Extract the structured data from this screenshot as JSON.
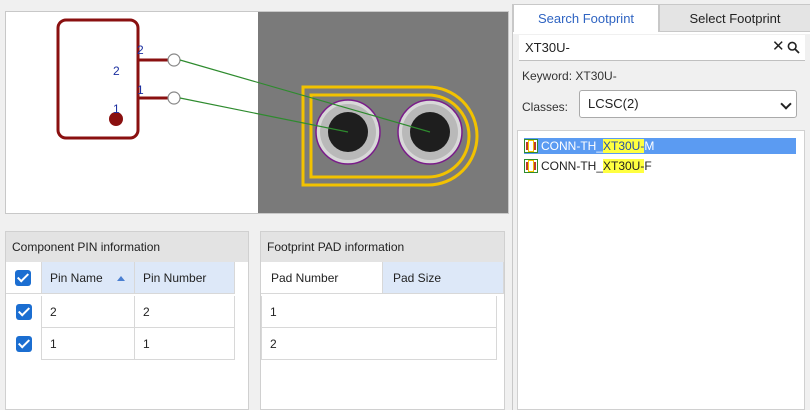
{
  "preview": {
    "symbol_pins": [
      {
        "label": "2",
        "number": "2"
      },
      {
        "label": "1",
        "number": "1"
      }
    ]
  },
  "pin_table": {
    "title": "Component PIN information",
    "columns": [
      "Pin Name",
      "Pin Number"
    ],
    "rows": [
      {
        "pin_name": "2",
        "pin_number": "2"
      },
      {
        "pin_name": "1",
        "pin_number": "1"
      }
    ]
  },
  "pad_table": {
    "title": "Footprint PAD information",
    "columns": [
      "Pad Number",
      "Pad Size"
    ],
    "rows": [
      {
        "pad_number": "1",
        "pad_size": ""
      },
      {
        "pad_number": "2",
        "pad_size": ""
      }
    ]
  },
  "tabs": [
    "Search Footprint",
    "Select Footprint"
  ],
  "search": {
    "value": "XT30U-"
  },
  "keyword": {
    "label": "Keyword: ",
    "value": "XT30U-"
  },
  "classes": {
    "label": "Classes:",
    "selected": "LCSC(2)"
  },
  "results": [
    {
      "prefix": "CONN-TH_",
      "match": "XT30U-",
      "suffix": "M",
      "selected": true
    },
    {
      "prefix": "CONN-TH_",
      "match": "XT30U-",
      "suffix": "F",
      "selected": false
    }
  ],
  "colors": {
    "symbol": "#8a1010",
    "pin_number": "#1b2fa0",
    "pcb_bg": "#7a7a7a",
    "silkscreen": "#f2c200",
    "pad": "#b9b9b9",
    "ratsnest": "#2e8b2e",
    "accent": "#1b6ed1",
    "highlight": "#ffff40"
  }
}
